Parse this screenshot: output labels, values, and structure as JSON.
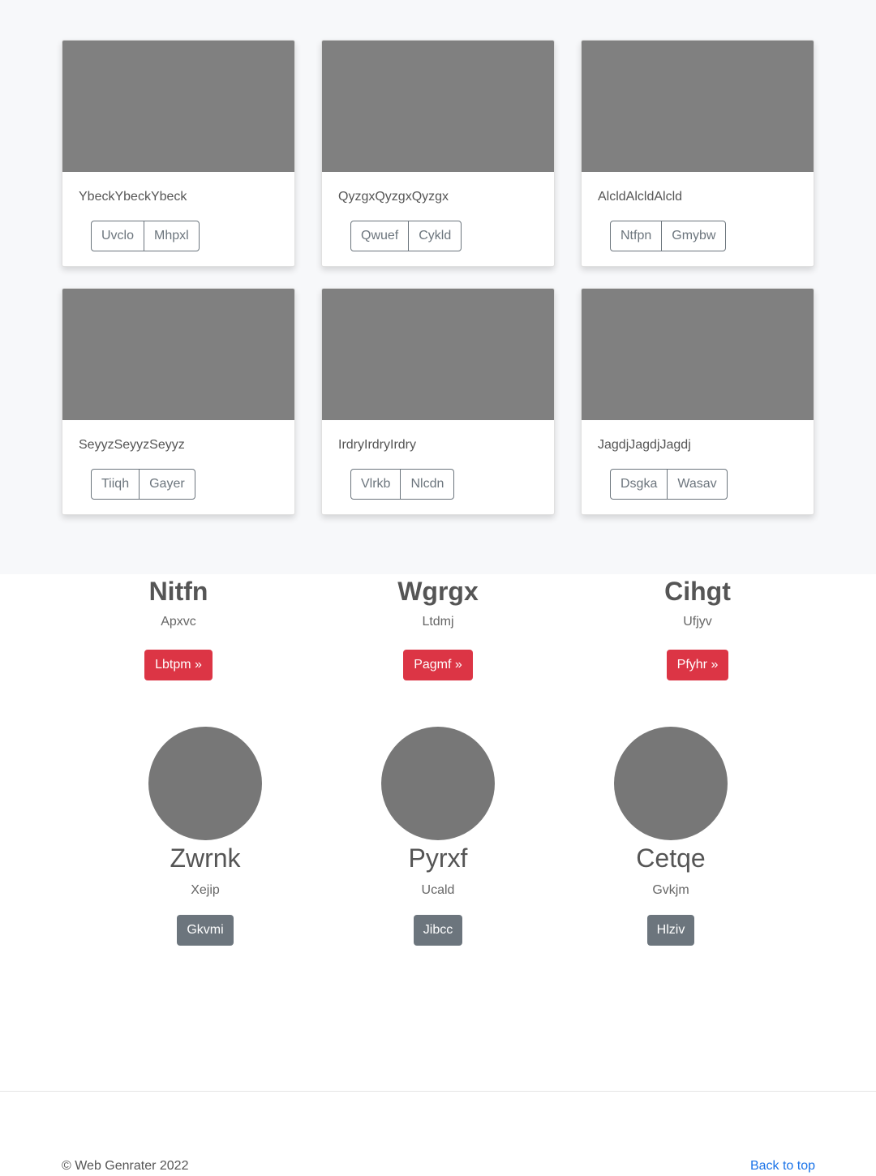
{
  "cards": [
    {
      "text": "YbeckYbeckYbeck",
      "buttons": [
        "Uvclo",
        "Mhpxl"
      ]
    },
    {
      "text": "QyzgxQyzgxQyzgx",
      "buttons": [
        "Qwuef",
        "Cykld"
      ]
    },
    {
      "text": "AlcldAlcldAlcld",
      "buttons": [
        "Ntfpn",
        "Gmybw"
      ]
    },
    {
      "text": "SeyyzSeyyzSeyyz",
      "buttons": [
        "Tiiqh",
        "Gayer"
      ]
    },
    {
      "text": "IrdryIrdryIrdry",
      "buttons": [
        "Vlrkb",
        "Nlcdn"
      ]
    },
    {
      "text": "JagdjJagdjJagdj",
      "buttons": [
        "Dsgka",
        "Wasav"
      ]
    }
  ],
  "marketing": [
    {
      "heading": "Nitfn",
      "text": "Apxvc",
      "button": "Lbtpm »"
    },
    {
      "heading": "Wgrgx",
      "text": "Ltdmj",
      "button": "Pagmf »"
    },
    {
      "heading": "Cihgt",
      "text": "Ufjyv",
      "button": "Pfyhr »"
    }
  ],
  "team": [
    {
      "name": "Zwrnk",
      "text": "Xejip",
      "button": "Gkvmi"
    },
    {
      "name": "Pyrxf",
      "text": "Ucald",
      "button": "Jibcc"
    },
    {
      "name": "Cetqe",
      "text": "Gvkjm",
      "button": "Hlziv"
    }
  ],
  "footer": {
    "copyright": "© Web Genrater 2022",
    "back_to_top": "Back to top"
  },
  "colors": {
    "album_background": "#f7f8fa",
    "thumbnail": "#808080",
    "danger": "#dc3545",
    "secondary": "#6c757d",
    "link": "#1a73e8"
  }
}
